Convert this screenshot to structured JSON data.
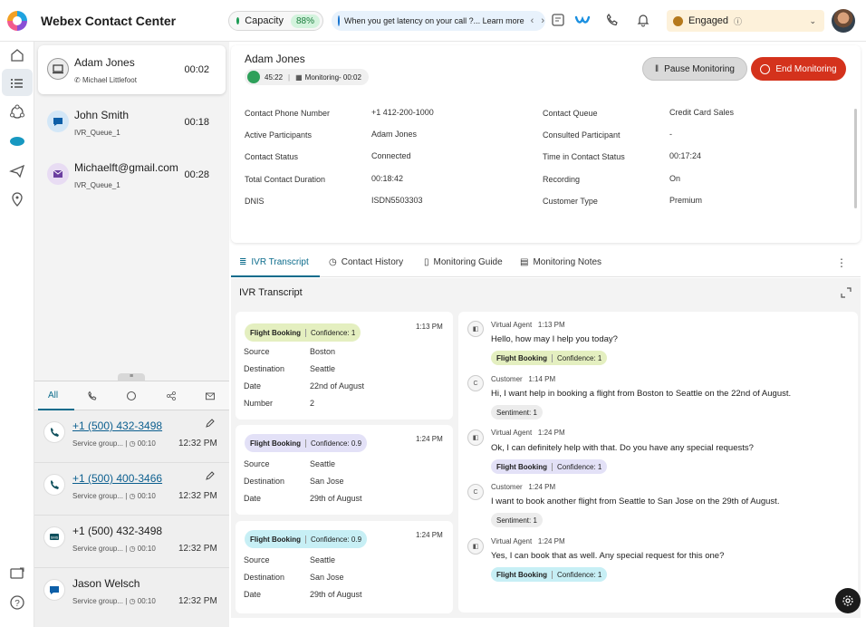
{
  "app": {
    "title": "Webex Contact Center"
  },
  "topbar": {
    "capacity_label": "Capacity",
    "capacity_value": "88%",
    "banner_text": "When you get latency on your call ?... Learn more",
    "agent_state": "Engaged"
  },
  "contacts": [
    {
      "name": "Adam Jones",
      "sub": "Michael Littlefoot",
      "time": "00:02",
      "selected": true
    },
    {
      "name": "John Smith",
      "sub": "IVR_Queue_1",
      "time": "00:18"
    },
    {
      "name": "Michaelft@gmail.com",
      "sub": "IVR_Queue_1",
      "time": "00:28"
    }
  ],
  "history": {
    "tabs": [
      "All"
    ],
    "items": [
      {
        "number": "+1 (500) 432-3498",
        "group": "Service group...",
        "duration": "00:10",
        "time": "12:32 PM"
      },
      {
        "number": "+1 (500) 400-3466",
        "group": "Service group...",
        "duration": "00:10",
        "time": "12:32 PM"
      },
      {
        "number": "+1 (500) 432-3498",
        "group": "Service group...",
        "duration": "00:10",
        "time": "12:32 PM"
      },
      {
        "number": "Jason Welsch",
        "group": "Service group...",
        "duration": "00:10",
        "time": "12:32 PM"
      }
    ]
  },
  "detail": {
    "name": "Adam Jones",
    "call_timer": "45:22",
    "monitoring": "Monitoring- 00:02",
    "pause_label": "Pause Monitoring",
    "end_label": "End Monitoring",
    "fields_left": [
      {
        "label": "Contact Phone Number",
        "value": "+1 412-200-1000"
      },
      {
        "label": "Active Participants",
        "value": "Adam Jones"
      },
      {
        "label": "Contact Status",
        "value": "Connected"
      },
      {
        "label": "Total Contact Duration",
        "value": "00:18:42"
      },
      {
        "label": "DNIS",
        "value": "ISDN5503303"
      }
    ],
    "fields_right": [
      {
        "label": "Contact Queue",
        "value": "Credit Card Sales"
      },
      {
        "label": "Consulted Participant",
        "value": "-"
      },
      {
        "label": "Time in Contact Status",
        "value": "00:17:24"
      },
      {
        "label": "Recording",
        "value": "On"
      },
      {
        "label": "Customer Type",
        "value": "Premium"
      }
    ]
  },
  "tabs": [
    "IVR Transcript",
    "Contact History",
    "Monitoring Guide",
    "Monitoring Notes"
  ],
  "transcript": {
    "title": "IVR Transcript",
    "intent_cards": [
      {
        "intent": "Flight Booking",
        "confidence": "Confidence: 1",
        "time": "1:13 PM",
        "color": "#e4efc0",
        "rows": [
          [
            "Source",
            "Boston"
          ],
          [
            "Destination",
            "Seattle"
          ],
          [
            "Date",
            "22nd of August"
          ],
          [
            "Number",
            "2"
          ]
        ]
      },
      {
        "intent": "Flight Booking",
        "confidence": "Confidence: 0.9",
        "time": "1:24 PM",
        "color": "#e3e1f7",
        "rows": [
          [
            "Source",
            "Seattle"
          ],
          [
            "Destination",
            "San Jose"
          ],
          [
            "Date",
            "29th of August"
          ]
        ]
      },
      {
        "intent": "Flight Booking",
        "confidence": "Confidence: 0.9",
        "time": "1:24 PM",
        "color": "#c7eff5",
        "rows": [
          [
            "Source",
            "Seattle"
          ],
          [
            "Destination",
            "San Jose"
          ],
          [
            "Date",
            "29th of August"
          ]
        ]
      }
    ],
    "messages": [
      {
        "who": "Virtual Agent",
        "time": "1:13 PM",
        "text": "Hello, how may I help you today?",
        "tag": [
          "Flight Booking",
          "Confidence: 1"
        ],
        "tagColor": "#e4efc0",
        "type": "agent"
      },
      {
        "who": "Customer",
        "time": "1:14 PM",
        "text": "Hi, I want help in booking a flight from Boston to Seattle on the 22nd of August.",
        "tag": [
          "Sentiment: 1"
        ],
        "tagColor": "#ececec",
        "type": "customer"
      },
      {
        "who": "Virtual Agent",
        "time": "1:24 PM",
        "text": "Ok, I can definitely help with that. Do you have any special requests?",
        "tag": [
          "Flight Booking",
          "Confidence: 1"
        ],
        "tagColor": "#e3e1f7",
        "type": "agent"
      },
      {
        "who": "Customer",
        "time": "1:24 PM",
        "text": "I want to book another flight from Seattle to San Jose on the 29th of August.",
        "tag": [
          "Sentiment: 1"
        ],
        "tagColor": "#ececec",
        "type": "customer"
      },
      {
        "who": "Virtual Agent",
        "time": "1:24 PM",
        "text": "Yes, I can book that as well. Any special request for this one?",
        "tag": [
          "Flight Booking",
          "Confidence: 1"
        ],
        "tagColor": "#c7eff5",
        "type": "agent"
      }
    ]
  },
  "colors": {
    "accent": "#0c6c8c",
    "end": "#d4321c",
    "link": "#0c5f8f"
  }
}
